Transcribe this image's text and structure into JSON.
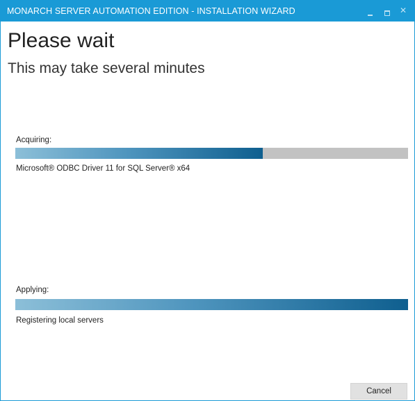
{
  "window": {
    "title": "MONARCH SERVER AUTOMATION EDITION - INSTALLATION WIZARD",
    "accent_color": "#1a9ad6",
    "controls": {
      "minimize_icon": "minimize-icon",
      "maximize_icon": "maximize-icon",
      "close_icon": "close-icon",
      "close_glyph": "✕"
    }
  },
  "main": {
    "heading": "Please wait",
    "subheading": "This may take several minutes"
  },
  "acquiring": {
    "label": "Acquiring:",
    "progress_percent": 63,
    "item": "Microsoft® ODBC Driver 11 for SQL Server® x64"
  },
  "applying": {
    "label": "Applying:",
    "progress_percent": 100,
    "item": "Registering local servers"
  },
  "footer": {
    "cancel_label": "Cancel"
  }
}
